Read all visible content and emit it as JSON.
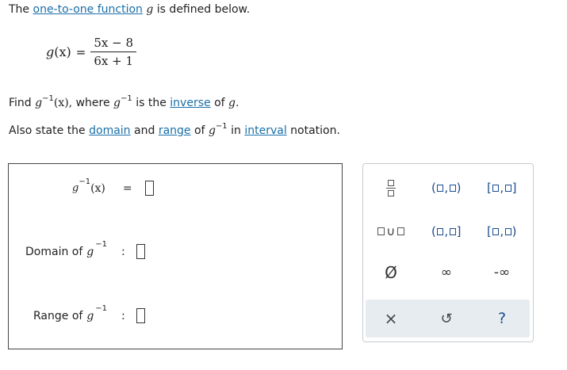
{
  "problem": {
    "line1_pre": "The",
    "line1_link": "one-to-one function",
    "line1_var": "g",
    "line1_post": "is defined below.",
    "definition": {
      "lhs_fn": "g",
      "lhs_arg": "(x)",
      "equals": "=",
      "numerator": "5x − 8",
      "denominator": "6x + 1"
    },
    "line2_pre": "Find",
    "line2_fn": "g",
    "inverse_exp": "−1",
    "line2_arg": "(x),",
    "line2_mid": "where",
    "line2_mid2": "is the",
    "line2_link": "inverse",
    "line2_of": "of",
    "line2_end": "g.",
    "line3_pre": "Also state the",
    "line3_link1": "domain",
    "line3_and": "and",
    "line3_link2": "range",
    "line3_of": "of",
    "line3_in": "in",
    "line3_link3": "interval",
    "line3_post": "notation."
  },
  "answers": {
    "inverse_label_fn": "g",
    "inverse_label_exp": "−1",
    "inverse_label_arg": "(x)",
    "inverse_eq": "=",
    "domain_label": "Domain of",
    "domain_fn": "g",
    "domain_exp": "−1",
    "domain_sep": ":",
    "range_label": "Range of",
    "range_fn": "g",
    "range_exp": "−1",
    "range_sep": ":"
  },
  "keypad": {
    "union": "∪",
    "empty_set": "Ø",
    "infinity": "∞",
    "neg_infinity": "-∞",
    "clear": "×",
    "undo": "↺",
    "help": "?"
  }
}
